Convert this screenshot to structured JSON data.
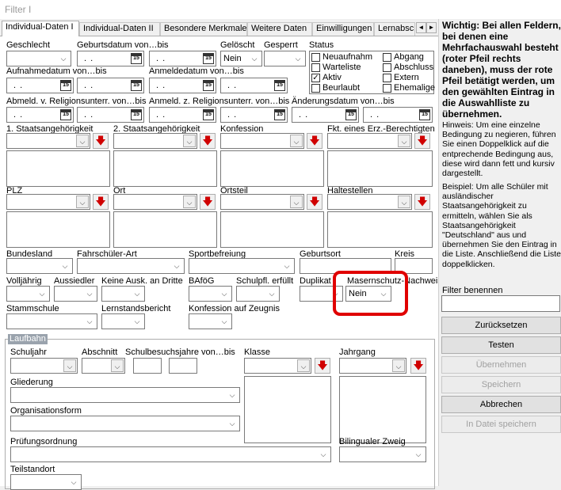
{
  "window": {
    "title": "Filter I"
  },
  "tabs": [
    "Individual-Daten I",
    "Individual-Daten II",
    "Besondere Merkmale",
    "Weitere Daten",
    "Einwilligungen",
    "Lernabsch"
  ],
  "tabnav": {
    "left": "◄",
    "right": "►"
  },
  "date_placeholder": ". .",
  "cal_icon": "15",
  "arrow_down": "⌵",
  "red_arrow": "🡇",
  "labels": {
    "geschlecht": "Geschlecht",
    "geburtsdatum": "Geburtsdatum von…bis",
    "geloescht": "Gelöscht",
    "gesperrt": "Gesperrt",
    "status": "Status",
    "aufnahmedatum": "Aufnahmedatum von…bis",
    "anmeldedatum": "Anmeldedatum von…bis",
    "abmeld": "Abmeld. v. Religionsunterr. von…bis",
    "anmeld": "Anmeld. z. Religionsunterr. von…bis",
    "aenderungsdatum": "Änderungsdatum von…bis",
    "staat1": "1. Staatsangehörigkeit",
    "staat2": "2. Staatsangehörigkeit",
    "konfession": "Konfession",
    "fkt": "Fkt. eines Erz.-Berechtigten",
    "plz": "PLZ",
    "ort": "Ort",
    "ortsteil": "Ortsteil",
    "haltestellen": "Haltestellen",
    "bundesland": "Bundesland",
    "fahrschueler": "Fahrschüler-Art",
    "sportbefreiung": "Sportbefreiung",
    "geburtsort": "Geburtsort",
    "kreis": "Kreis",
    "volljaehrig": "Volljährig",
    "aussiedler": "Aussiedler",
    "keineausk": "Keine Ausk. an Dritte",
    "bafoeg": "BAföG",
    "schulpfl": "Schulpfl. erfüllt",
    "duplikat": "Duplikat",
    "masern": "Masernschutz-Nachweis",
    "stammschule": "Stammschule",
    "lernstand": "Lernstandsbericht",
    "konfzeugnis": "Konfession auf Zeugnis"
  },
  "geloescht_value": "Nein",
  "masern_value": "Nein",
  "status_checks": [
    {
      "label": "Neuaufnahm",
      "checked": false
    },
    {
      "label": "Abgang",
      "checked": false
    },
    {
      "label": "Warteliste",
      "checked": false
    },
    {
      "label": "Abschluss",
      "checked": false
    },
    {
      "label": "Aktiv",
      "checked": true
    },
    {
      "label": "Extern",
      "checked": false
    },
    {
      "label": "Beurlaubt",
      "checked": false
    },
    {
      "label": "Ehemalige",
      "checked": false
    }
  ],
  "laufbahn": {
    "title": "Laufbahn",
    "schuljahr": "Schuljahr",
    "abschnitt": "Abschnitt",
    "schulbesuch": "Schulbesuchsjahre von…bis",
    "klasse": "Klasse",
    "jahrgang": "Jahrgang",
    "gliederung": "Gliederung",
    "orgform": "Organisationsform",
    "pruefung": "Prüfungsordnung",
    "bilingual": "Bilingualer Zweig",
    "teilstandort": "Teilstandort"
  },
  "sidebar": {
    "warning": "Wichtig: Bei allen Feldern, bei denen eine Mehrfachauswahl besteht (roter Pfeil rechts daneben), muss der rote Pfeil betätigt werden, um den gewählten Eintrag in die Auswahlliste zu übernehmen.",
    "hint1": "Hinweis: Um eine einzelne Bedingung zu negieren, führen Sie einen Doppelklick auf die entprechende Bedingung aus, diese wird dann fett und kursiv dargestellt.",
    "hint2": "Beispiel: Um alle Schüler mit ausländischer Staatsangehörigkeit zu ermitteln, wählen Sie als Staatsangehörigkeit \"Deutschland\" aus und übernehmen Sie den Eintrag in die Liste. Anschließend die Liste doppelklicken.",
    "filter_label": "Filter benennen",
    "buttons": [
      {
        "label": "Zurücksetzen",
        "enabled": true
      },
      {
        "label": "Testen",
        "enabled": true
      },
      {
        "label": "Übernehmen",
        "enabled": false
      },
      {
        "label": "Speichern",
        "enabled": false
      },
      {
        "label": "Abbrechen",
        "enabled": true
      },
      {
        "label": "In Datei speichern",
        "enabled": false
      }
    ]
  },
  "colors": {
    "highlight": "#e00000",
    "red_arrow": "#d00000",
    "group_label": "#9aa3ad"
  }
}
